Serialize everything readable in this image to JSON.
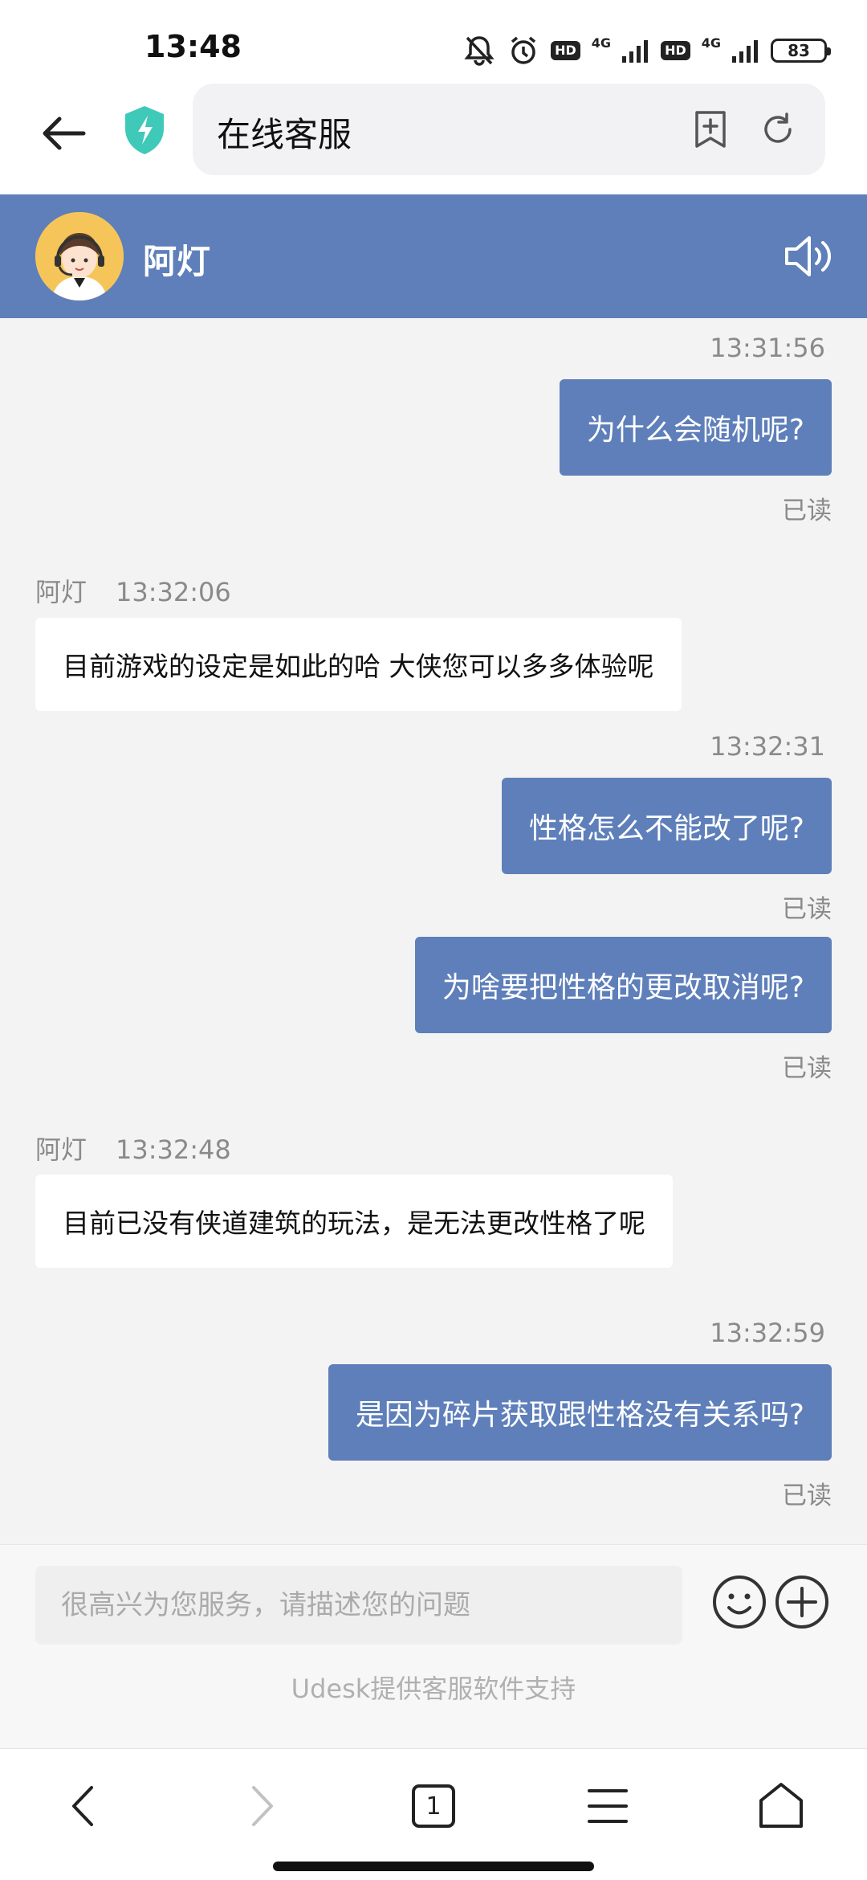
{
  "status_bar": {
    "time": "13:48",
    "network_1": "4G",
    "network_2": "4G",
    "hd_1": "HD",
    "hd_2": "HD",
    "battery": "83"
  },
  "browser": {
    "title": "在线客服",
    "icons": [
      "back-arrow-icon",
      "shield-icon",
      "bookmark-add-icon",
      "reload-icon"
    ]
  },
  "chat_header": {
    "agent_name": "阿灯",
    "icons": [
      "avatar",
      "speaker-icon"
    ],
    "color": "#5e7fba"
  },
  "messages": [
    {
      "type": "outgoing",
      "time": "13:31:56",
      "text": "为什么会随机呢?",
      "status": "已读"
    },
    {
      "type": "incoming",
      "sender": "阿灯",
      "time": "13:32:06",
      "text": "目前游戏的设定是如此的哈 大侠您可以多多体验呢"
    },
    {
      "type": "outgoing",
      "time": "13:32:31",
      "text": "性格怎么不能改了呢?",
      "status": "已读"
    },
    {
      "type": "outgoing",
      "time": "",
      "text": "为啥要把性格的更改取消呢?",
      "status": "已读"
    },
    {
      "type": "incoming",
      "sender": "阿灯",
      "time": "13:32:48",
      "text": "目前已没有侠道建筑的玩法，是无法更改性格了呢"
    },
    {
      "type": "outgoing",
      "time": "13:32:59",
      "text": "是因为碎片获取跟性格没有关系吗?",
      "status": "已读"
    }
  ],
  "input": {
    "placeholder": "很高兴为您服务，请描述您的问题",
    "powered_by": "Udesk提供客服软件支持"
  },
  "bottom_nav": {
    "tab_count": "1",
    "icons": [
      "nav-back-icon",
      "nav-forward-icon",
      "tabs-icon",
      "menu-icon",
      "home-icon"
    ]
  }
}
